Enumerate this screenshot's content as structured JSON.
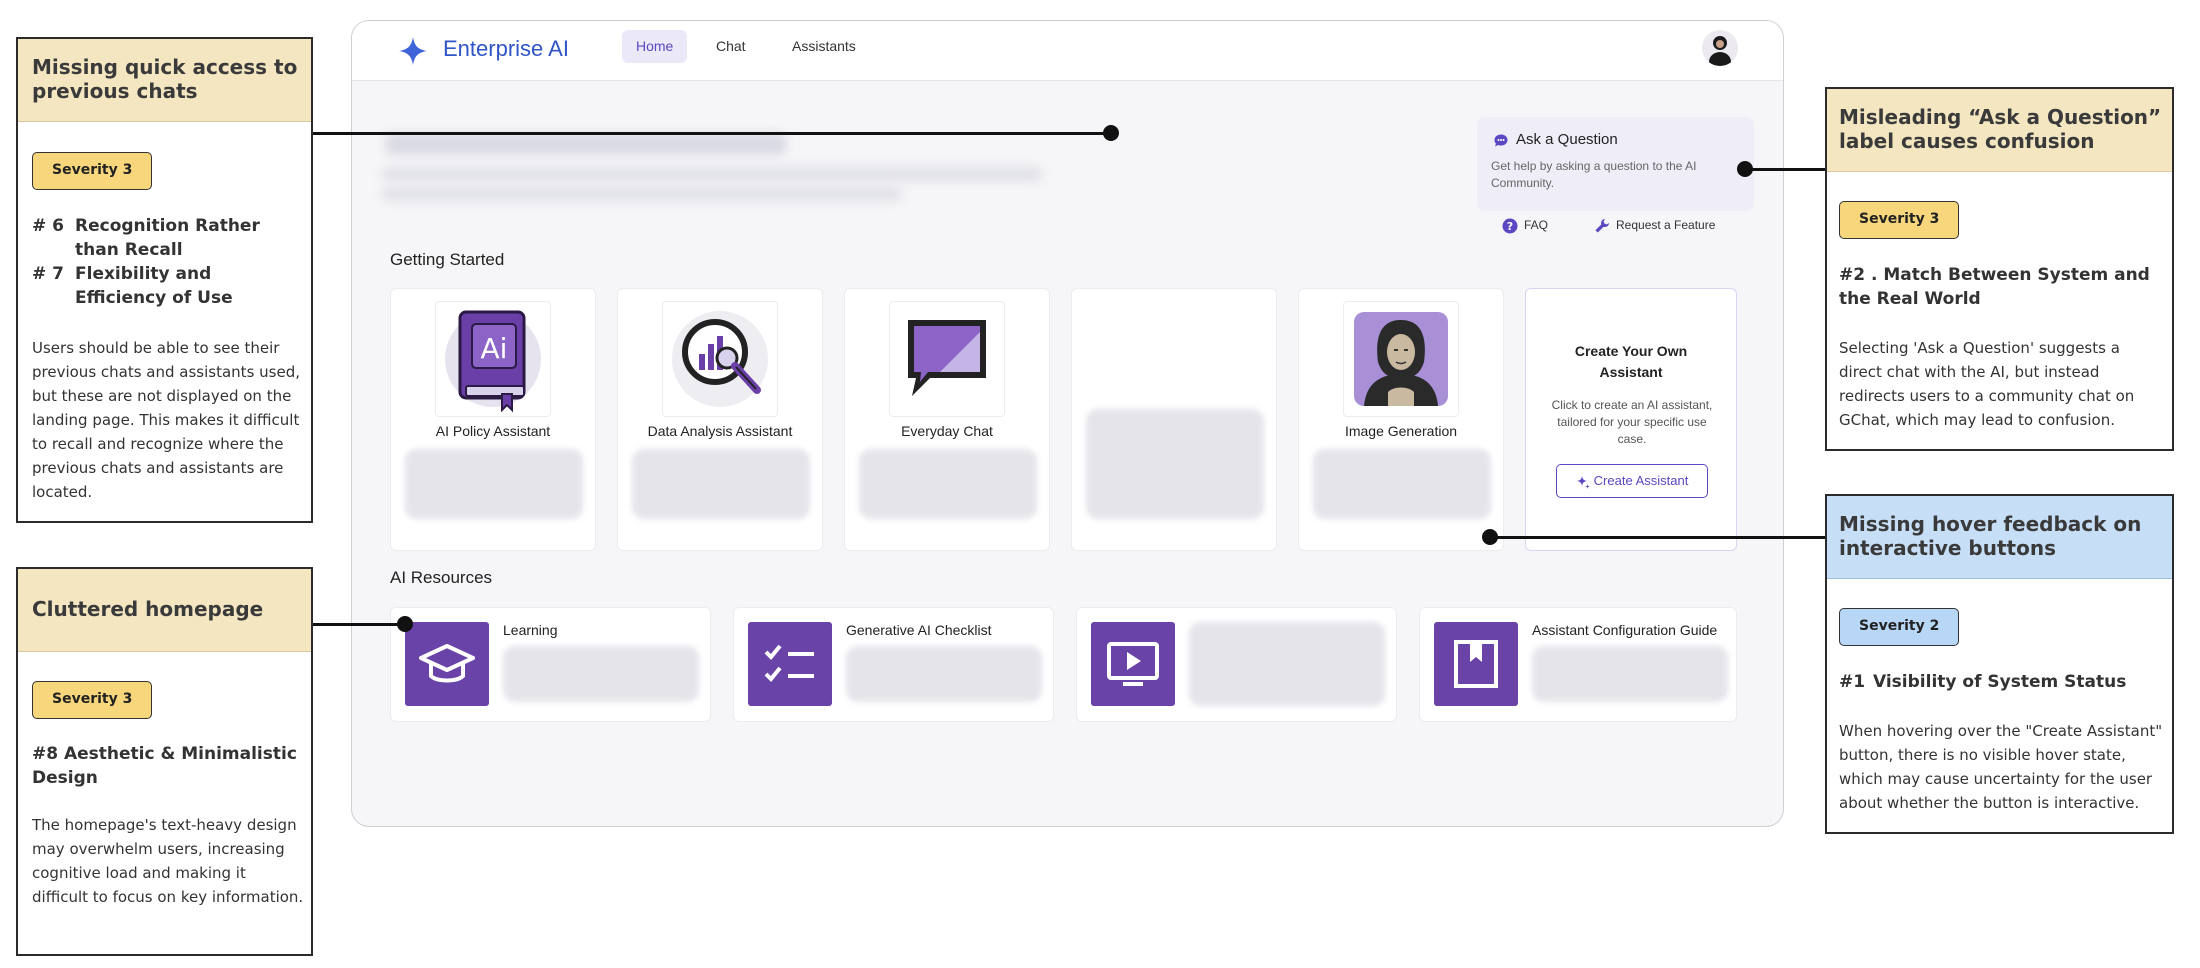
{
  "app": {
    "brand": "Enterprise AI",
    "nav": [
      {
        "label": "Home"
      },
      {
        "label": "Chat"
      },
      {
        "label": "Assistants"
      }
    ],
    "ask_card": {
      "title": "Ask a Question",
      "description": "Get help by asking a question to the AI Community."
    },
    "links": {
      "faq": "FAQ",
      "request_feature": "Request a Feature"
    },
    "getting_started": {
      "heading": "Getting Started",
      "cards": [
        {
          "name": "AI Policy Assistant",
          "icon": "ai-book-icon"
        },
        {
          "name": "Data Analysis Assistant",
          "icon": "chart-magnifier-icon"
        },
        {
          "name": "Everyday Chat",
          "icon": "chat-bubble-icon"
        },
        {
          "name": "",
          "icon": ""
        },
        {
          "name": "Image Generation",
          "icon": "portrait-painting-icon"
        }
      ],
      "create_card": {
        "title": "Create Your Own Assistant",
        "description": "Click to create an AI assistant, tailored for your specific use case.",
        "button": "Create Assistant"
      }
    },
    "resources": {
      "heading": "AI Resources",
      "items": [
        {
          "title": "Learning",
          "icon": "graduation-cap-icon"
        },
        {
          "title": "Generative AI Checklist",
          "icon": "checklist-icon"
        },
        {
          "title": "",
          "icon": "video-play-icon"
        },
        {
          "title": "Assistant Configuration Guide",
          "icon": "bookmark-book-icon"
        }
      ]
    }
  },
  "annotations": {
    "quick_access": {
      "title": "Missing quick access to previous chats",
      "severity": "Severity 3",
      "heuristics": [
        {
          "num": "# 6",
          "text": "Recognition Rather than Recall"
        },
        {
          "num": "# 7",
          "text": "Flexibility and Efficiency of Use"
        }
      ],
      "description": "Users should be able to see their previous chats and assistants used, but these are not displayed on the landing page. This makes it difficult to recall and recognize where the previous chats and assistants are located."
    },
    "cluttered": {
      "title": "Cluttered homepage",
      "severity": "Severity 3",
      "heuristic": "#8 Aesthetic & Minimalistic Design",
      "description": "The homepage's text-heavy design may overwhelm users, increasing cognitive load and making it difficult to focus on key information."
    },
    "ask_label": {
      "title": "Misleading “Ask a Question” label causes confusion",
      "severity": "Severity 3",
      "heuristic": "#2 .  Match Between System and the Real World",
      "description": "Selecting 'Ask a Question' suggests a direct chat with the AI, but instead redirects users to a community chat on GChat, which may lead to confusion."
    },
    "hover": {
      "title": "Missing hover feedback on interactive buttons",
      "severity": "Severity 2",
      "heuristic_num": "#1",
      "heuristic_text": "Visibility of System Status",
      "description": "When hovering over the \"Create Assistant\" button, there is no visible hover state, which may cause uncertainty for the user about whether the button is interactive."
    }
  },
  "colors": {
    "brand_blue": "#2f55c6",
    "accent_purple": "#5b47c2",
    "resource_purple": "#6a43a8",
    "severity_yellow": "#f8d67b",
    "severity_blue": "#b8d7f6",
    "header_tan": "#f3e6c1",
    "header_blue": "#c7def7"
  }
}
